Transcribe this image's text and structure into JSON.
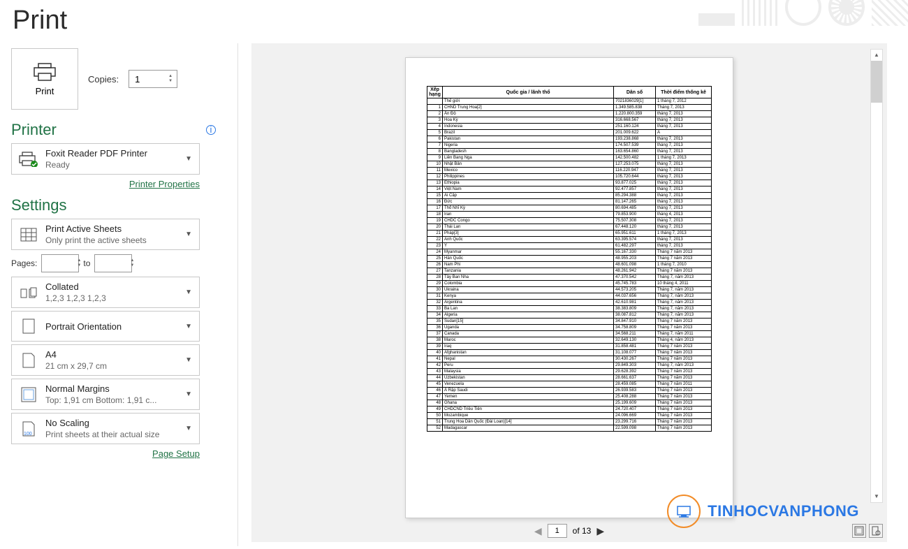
{
  "title": "Print",
  "print_button": "Print",
  "copies_label": "Copies:",
  "copies_value": "1",
  "printer": {
    "heading": "Printer",
    "name": "Foxit Reader PDF Printer",
    "status": "Ready",
    "properties_link": "Printer Properties"
  },
  "settings": {
    "heading": "Settings",
    "what": {
      "main": "Print Active Sheets",
      "sub": "Only print the active sheets"
    },
    "pages_label": "Pages:",
    "to_label": "to",
    "collate": {
      "main": "Collated",
      "sub": "1,2,3    1,2,3    1,2,3"
    },
    "orient": {
      "main": "Portrait Orientation",
      "sub": ""
    },
    "size": {
      "main": "A4",
      "sub": "21 cm x 29,7 cm"
    },
    "margins": {
      "main": "Normal Margins",
      "sub": "Top: 1,91 cm Bottom: 1,91 c..."
    },
    "scale": {
      "main": "No Scaling",
      "sub": "Print sheets at their actual size"
    },
    "page_setup_link": "Page Setup"
  },
  "nav": {
    "page": "1",
    "total": "of 13"
  },
  "watermark": "TINHOCVANPHONG",
  "table": {
    "headers": [
      "Xếp hạng",
      "Quốc gia / lãnh thổ",
      "Dân số",
      "Thời điểm thống kê"
    ],
    "rows": [
      [
        "",
        "Thế giới",
        "7021836029[1]",
        "1 tháng 7, 2012"
      ],
      [
        "1",
        "CHND Trung Hoa[2]",
        "1.349.585.838",
        "Tháng 7, 2013"
      ],
      [
        "2",
        "Ấn Độ",
        "1.220.800.359",
        "tháng 7, 2013"
      ],
      [
        "3",
        "Hoa Kỳ",
        "316.668.567",
        "tháng 7, 2013"
      ],
      [
        "4",
        "Indonesia",
        "251.160.124",
        "tháng 7, 2013"
      ],
      [
        "5",
        "Brazil",
        "201.009.622",
        "A"
      ],
      [
        "6",
        "Pakistan",
        "193.238.868",
        "tháng 7, 2013"
      ],
      [
        "7",
        "Nigeria",
        "174.507.539",
        "tháng 7, 2013"
      ],
      [
        "8",
        "Bangladesh",
        "163.654.860",
        "tháng 7, 2013"
      ],
      [
        "9",
        "Liên Bang Nga",
        "142.500.482",
        "1 tháng 7, 2013"
      ],
      [
        "10",
        "Nhật Bản",
        "127.253.075",
        "tháng 7, 2013"
      ],
      [
        "11",
        "Mexico",
        "116.220.947",
        "tháng 7, 2013"
      ],
      [
        "12",
        "Philippines",
        "105.720.644",
        "tháng 7, 2013"
      ],
      [
        "13",
        "Ethiopia",
        "93.877.025",
        "tháng 7, 2013"
      ],
      [
        "14",
        "Việt Nam",
        "92.477.857",
        "tháng 7, 2013"
      ],
      [
        "15",
        "Ai Cập",
        "85.294.388",
        "tháng 7, 2013"
      ],
      [
        "16",
        "Đức",
        "81.147.265",
        "tháng 7, 2013"
      ],
      [
        "17",
        "Thổ Nhĩ Kỳ",
        "80.694.485",
        "tháng 7, 2013"
      ],
      [
        "18",
        "Iran",
        "79.853.900",
        "tháng 4, 2013"
      ],
      [
        "19",
        "CHDC Congo",
        "75.507.308",
        "tháng 7, 2013"
      ],
      [
        "20",
        "Thái Lan",
        "67.448.120",
        "tháng 7, 2013"
      ],
      [
        "21",
        "Pháp[3]",
        "65.951.611",
        "1 tháng 7, 2013"
      ],
      [
        "22",
        "Anh Quốc",
        "63.395.574",
        "tháng 7, 2013"
      ],
      [
        "23",
        "Ý",
        "61.482.297",
        "tháng 7, 2013"
      ],
      [
        "24",
        "Myanmar",
        "55.167.330",
        "Tháng 7 năm 2013"
      ],
      [
        "25",
        "Hàn Quốc",
        "48.955.203",
        "Tháng 7 năm 2013"
      ],
      [
        "26",
        "Nam Phi",
        "48.601.098",
        "1 tháng 7, 2010"
      ],
      [
        "27",
        "Tanzania",
        "48.261.942",
        "Tháng 7 năm 2013"
      ],
      [
        "28",
        "Tây Ban Nha",
        "47.370.542",
        "Tháng 7, năm 2013"
      ],
      [
        "29",
        "Colombia",
        "45.745.783",
        "10 tháng 4, 2011"
      ],
      [
        "30",
        "Ukraina",
        "44.573.205",
        "Tháng 7, năm 2013"
      ],
      [
        "31",
        "Kenya",
        "44.037.656",
        "Tháng 7, năm 2013"
      ],
      [
        "32",
        "Argentina",
        "42.610.981",
        "Tháng 7, năm 2013"
      ],
      [
        "33",
        "Ba Lan",
        "38.383.809",
        "Tháng 7, năm 2013"
      ],
      [
        "34",
        "Algeria",
        "38.087.812",
        "Tháng 7, năm 2013"
      ],
      [
        "35",
        "Sudan[15]",
        "34.847.910",
        "Tháng 7 năm 2013"
      ],
      [
        "36",
        "Uganda",
        "34.758.809",
        "Tháng 7 năm 2013"
      ],
      [
        "37",
        "Canada",
        "34.568.211",
        "Tháng 7, năm 2011"
      ],
      [
        "38",
        "Maroc",
        "32.649.130",
        "Tháng 4, năm 2013"
      ],
      [
        "39",
        "Iraq",
        "31.858.481",
        "Tháng 7 năm 2013"
      ],
      [
        "40",
        "Afghanistan",
        "31.108.077",
        "Tháng 7 năm 2013"
      ],
      [
        "41",
        "Nepal",
        "30.430.267",
        "Tháng 7 năm 2013"
      ],
      [
        "42",
        "Peru",
        "29.849.303",
        "Tháng 7, năm 2013"
      ],
      [
        "43",
        "Malaysia",
        "29.628.392",
        "Tháng 7 năm 2013"
      ],
      [
        "44",
        "Uzbekistan",
        "28.661.637",
        "Tháng 7 năm 2013"
      ],
      [
        "45",
        "Venezuela",
        "28.459.085",
        "Tháng 7 năm 2011"
      ],
      [
        "46",
        "Ả Rập Saudi",
        "26.939.583",
        "Tháng 7 năm 2013"
      ],
      [
        "47",
        "Yemen",
        "25.408.288",
        "Tháng 7 năm 2013"
      ],
      [
        "48",
        "Ghana",
        "25.199.609",
        "Tháng 7 năm 2013"
      ],
      [
        "49",
        "CHDCND Triều Tiên",
        "24.720.407",
        "Tháng 7 năm 2013"
      ],
      [
        "50",
        "Mozambique",
        "24.096.669",
        "Tháng 7 năm 2013"
      ],
      [
        "51",
        "Trung Hoa Dân Quốc (Đài Loan)[14]",
        "23.299.716",
        "Tháng 7 năm 2013"
      ],
      [
        "52",
        "Madagascar",
        "22.599.098",
        "Tháng 7 năm 2013"
      ]
    ]
  }
}
